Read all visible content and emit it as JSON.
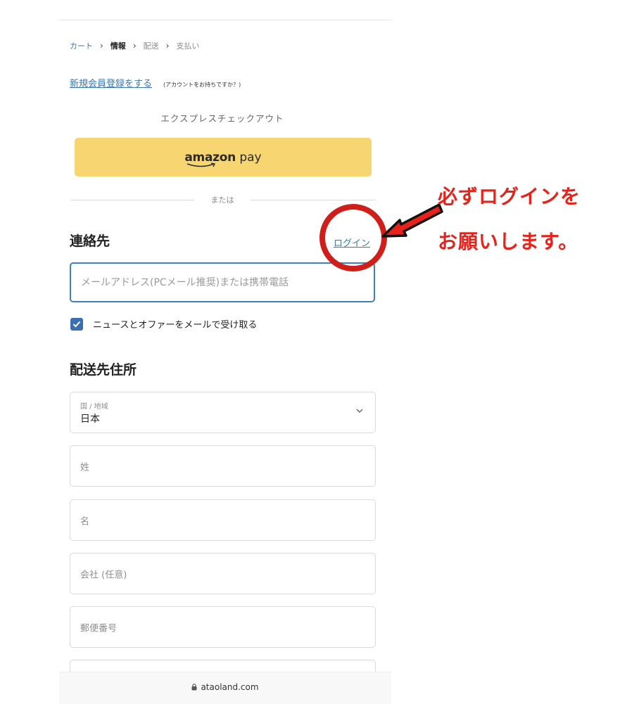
{
  "breadcrumb": {
    "cart": "カート",
    "info": "情報",
    "shipping": "配送",
    "payment": "支払い"
  },
  "account": {
    "register_link": "新規会員登録をする",
    "register_note": "(アカウントをお持ちですか？)"
  },
  "express": {
    "title": "エクスプレスチェックアウト",
    "amazon_word": "amazon",
    "amazon_pay": "pay"
  },
  "divider_text": "または",
  "contact": {
    "heading": "連絡先",
    "login_link": "ログイン",
    "email_placeholder": "メールアドレス(PCメール推奨)または携帯電話",
    "newsletter_label": "ニュースとオファーをメールで受け取る",
    "newsletter_checked": true
  },
  "shipping": {
    "heading": "配送先住所",
    "country_label": "国 / 地域",
    "country_value": "日本",
    "last_name": "姓",
    "first_name": "名",
    "company": "会社 (任意)",
    "postal_code": "郵便番号"
  },
  "browser": {
    "url": "ataoland.com"
  },
  "annotation": {
    "line1": "必ずログインを",
    "line2": "お願いします。"
  },
  "colors": {
    "accent": "#3a77b0",
    "amazon_button": "#f7d571",
    "annotation_red": "#e8211b"
  }
}
